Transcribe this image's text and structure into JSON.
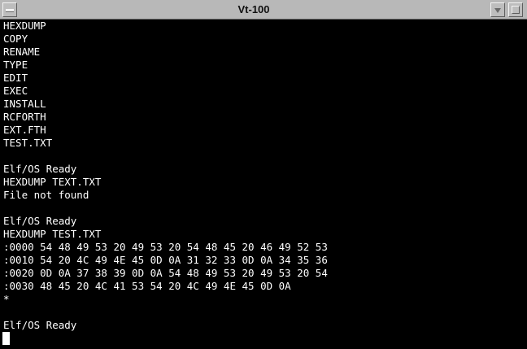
{
  "window": {
    "title": "Vt-100"
  },
  "terminal": {
    "lines": [
      "HEXDUMP",
      "COPY",
      "RENAME",
      "TYPE",
      "EDIT",
      "EXEC",
      "INSTALL",
      "RCFORTH",
      "EXT.FTH",
      "TEST.TXT",
      "",
      "Elf/OS Ready",
      "HEXDUMP TEXT.TXT",
      "File not found",
      "",
      "Elf/OS Ready",
      "HEXDUMP TEST.TXT",
      ":0000 54 48 49 53 20 49 53 20 54 48 45 20 46 49 52 53",
      ":0010 54 20 4C 49 4E 45 0D 0A 31 32 33 0D 0A 34 35 36",
      ":0020 0D 0A 37 38 39 0D 0A 54 48 49 53 20 49 53 20 54",
      ":0030 48 45 20 4C 41 53 54 20 4C 49 4E 45 0D 0A",
      "*",
      "",
      "Elf/OS Ready"
    ]
  }
}
